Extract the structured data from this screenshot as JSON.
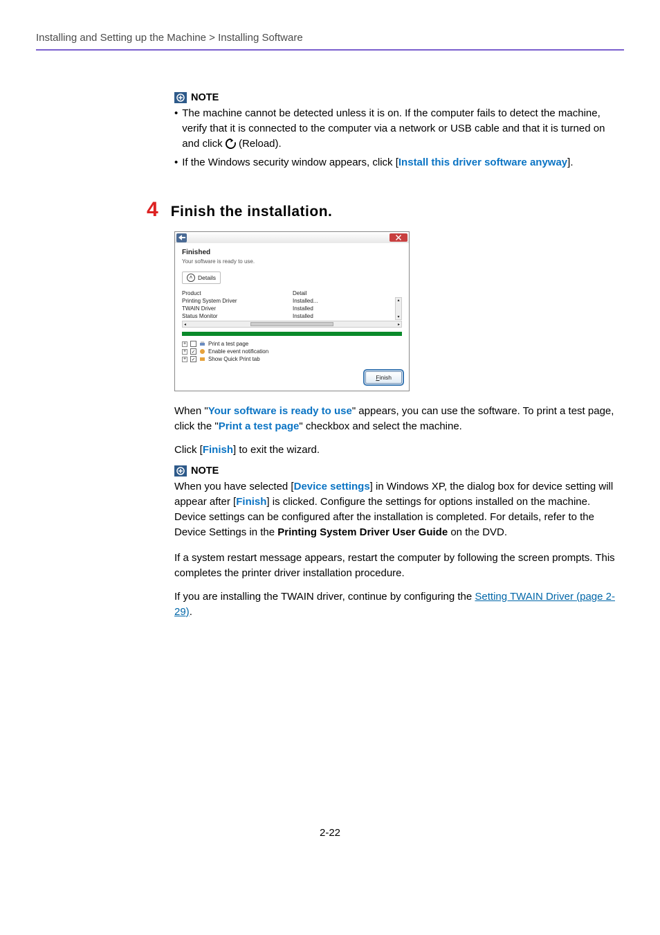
{
  "breadcrumb": "Installing and Setting up the Machine > Installing Software",
  "note1": {
    "label": "NOTE",
    "bullet1_a": "The machine cannot be detected unless it is on. If the computer fails to detect the machine, verify that it is connected to the computer via a network or USB cable and that it is turned on and click ",
    "bullet1_b": " (Reload).",
    "bullet2_a": "If the Windows security window appears, click [",
    "bullet2_link": "Install this driver software anyway",
    "bullet2_b": "]."
  },
  "step": {
    "num": "4",
    "title": "Finish the installation."
  },
  "dialog": {
    "finished": "Finished",
    "ready": "Your software is ready to use.",
    "details": "Details",
    "col_product": "Product",
    "col_detail": "Detail",
    "rows": [
      {
        "p": "Printing System Driver",
        "d": "Installed..."
      },
      {
        "p": "TWAIN Driver",
        "d": "Installed"
      },
      {
        "p": "Status Monitor",
        "d": "Installed"
      }
    ],
    "opt1": "Print a test page",
    "opt2": "Enable event notification",
    "opt3": "Show Quick Print tab",
    "finish": "Finish"
  },
  "para1_a": "When \"",
  "para1_link1": "Your software is ready to use",
  "para1_b": "\" appears, you can use the software. To print a test page, click the \"",
  "para1_link2": "Print a test page",
  "para1_c": "\" checkbox and select the machine.",
  "para2_a": "Click [",
  "para2_link": "Finish",
  "para2_b": "] to exit the wizard.",
  "note2": {
    "label": "NOTE",
    "a": "When you have selected [",
    "l1": "Device settings",
    "b": "] in Windows XP, the dialog box for device setting will appear after [",
    "l2": "Finish",
    "c": "] is clicked. Configure the settings for options installed on the machine. Device settings can be configured after the installation is completed. For details, refer to the Device Settings in the ",
    "bold": "Printing System Driver User Guide",
    "d": " on the DVD."
  },
  "para3": "If a system restart message appears, restart the computer by following the screen prompts. This completes the printer driver installation procedure.",
  "para4_a": "If you are installing the TWAIN driver, continue by configuring the ",
  "para4_link": "Setting TWAIN Driver (page 2-29)",
  "para4_b": ".",
  "pagenum": "2-22"
}
